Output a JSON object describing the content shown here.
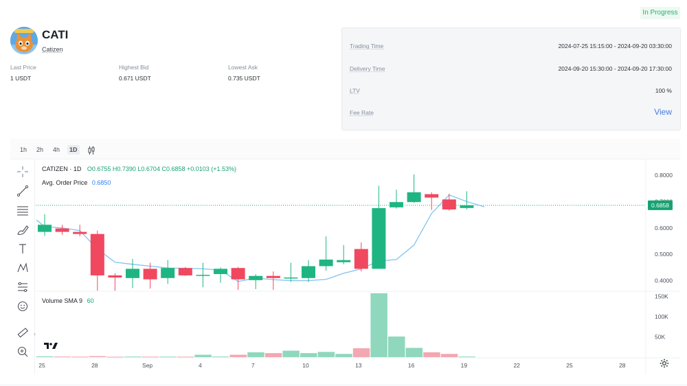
{
  "status": "In Progress",
  "token": {
    "symbol": "CATI",
    "name": "Catizen"
  },
  "stats": [
    {
      "label": "Last Price",
      "value": "1 USDT"
    },
    {
      "label": "Highest Bid",
      "value": "0.671 USDT"
    },
    {
      "label": "Lowest Ask",
      "value": "0.735 USDT"
    }
  ],
  "info": {
    "trading_time_label": "Trading Time",
    "trading_time_value": "2024-07-25 15:15:00 - 2024-09-20 03:30:00",
    "delivery_time_label": "Delivery Time",
    "delivery_time_value": "2024-09-20 15:30:00 - 2024-09-20 17:30:00",
    "ltv_label": "LTV",
    "ltv_value": "100 %",
    "fee_rate_label": "Fee Rate",
    "fee_rate_link": "View"
  },
  "intervals": [
    "1h",
    "2h",
    "4h",
    "1D"
  ],
  "active_interval": "1D",
  "tools": [
    "crosshair-icon",
    "trend-line-icon",
    "fib-retracement-icon",
    "brush-icon",
    "text-tool-icon",
    "pattern-icon",
    "forecast-icon",
    "emoji-icon",
    "ruler-icon",
    "zoom-in-icon"
  ],
  "legend": {
    "title": "CATIZEN · 1D",
    "ohlc": "O0.6755 H0.7390 L0.6704 C0.6858 +0.0103 (+1.53%)",
    "avg_label": "Avg. Order Price",
    "avg_value": "0.6850",
    "volume_label": "Volume SMA 9",
    "volume_value": "60"
  },
  "colors": {
    "up": "#1fb582",
    "down": "#f0485f",
    "up_volume": "#8fd8bd",
    "down_volume": "#f4a7b1",
    "sma": "#7fc3ef",
    "price_tag": "#16a371",
    "accent": "#3f7ce0"
  },
  "chart_data": {
    "type": "candlestick",
    "x_tick_labels": [
      "25",
      "28",
      "Sep",
      "4",
      "7",
      "10",
      "13",
      "16",
      "19",
      "22",
      "25",
      "28"
    ],
    "price_axis_labels": [
      "0.8000",
      "0.7000",
      "0.6000",
      "0.5000",
      "0.4000"
    ],
    "price_ylim": [
      0.36,
      0.86
    ],
    "last_price": 0.6858,
    "last_price_label": "0.6858",
    "volume_axis_labels": [
      "150K",
      "100K",
      "50K"
    ],
    "volume_ylim": [
      0,
      163000
    ],
    "candles": [
      {
        "o": 0.585,
        "h": 0.652,
        "l": 0.57,
        "c": 0.612,
        "v": 2000
      },
      {
        "o": 0.598,
        "h": 0.612,
        "l": 0.574,
        "c": 0.585,
        "v": 1500
      },
      {
        "o": 0.585,
        "h": 0.612,
        "l": 0.568,
        "c": 0.577,
        "v": 1200
      },
      {
        "o": 0.577,
        "h": 0.59,
        "l": 0.362,
        "c": 0.42,
        "v": 2500
      },
      {
        "o": 0.42,
        "h": 0.428,
        "l": 0.362,
        "c": 0.412,
        "v": 1000
      },
      {
        "o": 0.41,
        "h": 0.482,
        "l": 0.372,
        "c": 0.445,
        "v": 1500
      },
      {
        "o": 0.445,
        "h": 0.468,
        "l": 0.37,
        "c": 0.405,
        "v": 1200
      },
      {
        "o": 0.41,
        "h": 0.478,
        "l": 0.388,
        "c": 0.448,
        "v": 1300
      },
      {
        "o": 0.448,
        "h": 0.452,
        "l": 0.418,
        "c": 0.42,
        "v": 1200
      },
      {
        "o": 0.42,
        "h": 0.468,
        "l": 0.375,
        "c": 0.422,
        "v": 6000
      },
      {
        "o": 0.425,
        "h": 0.45,
        "l": 0.392,
        "c": 0.445,
        "v": 1500
      },
      {
        "o": 0.448,
        "h": 0.452,
        "l": 0.365,
        "c": 0.405,
        "v": 6000
      },
      {
        "o": 0.402,
        "h": 0.425,
        "l": 0.368,
        "c": 0.418,
        "v": 12000
      },
      {
        "o": 0.418,
        "h": 0.435,
        "l": 0.365,
        "c": 0.41,
        "v": 10000
      },
      {
        "o": 0.41,
        "h": 0.468,
        "l": 0.395,
        "c": 0.412,
        "v": 16000
      },
      {
        "o": 0.41,
        "h": 0.478,
        "l": 0.395,
        "c": 0.455,
        "v": 10000
      },
      {
        "o": 0.455,
        "h": 0.568,
        "l": 0.438,
        "c": 0.48,
        "v": 13000
      },
      {
        "o": 0.47,
        "h": 0.535,
        "l": 0.462,
        "c": 0.478,
        "v": 8000
      },
      {
        "o": 0.52,
        "h": 0.545,
        "l": 0.435,
        "c": 0.445,
        "v": 22000
      },
      {
        "o": 0.445,
        "h": 0.76,
        "l": 0.445,
        "c": 0.675,
        "v": 158000
      },
      {
        "o": 0.678,
        "h": 0.745,
        "l": 0.673,
        "c": 0.698,
        "v": 51000
      },
      {
        "o": 0.698,
        "h": 0.803,
        "l": 0.695,
        "c": 0.735,
        "v": 23000
      },
      {
        "o": 0.728,
        "h": 0.735,
        "l": 0.668,
        "c": 0.715,
        "v": 12000
      },
      {
        "o": 0.708,
        "h": 0.73,
        "l": 0.665,
        "c": 0.67,
        "v": 8000
      },
      {
        "o": 0.6755,
        "h": 0.739,
        "l": 0.6704,
        "c": 0.6858,
        "v": 1500
      }
    ],
    "avg_order_price_series": [
      0.63,
      0.605,
      0.6,
      0.59,
      0.52,
      0.47,
      0.462,
      0.455,
      0.448,
      0.447,
      0.445,
      0.44,
      0.397,
      0.41,
      0.404,
      0.4,
      0.4,
      0.405,
      0.428,
      0.445,
      0.475,
      0.48,
      0.535,
      0.655,
      0.725,
      0.7,
      0.68
    ],
    "xlabel": "",
    "ylabel": ""
  }
}
